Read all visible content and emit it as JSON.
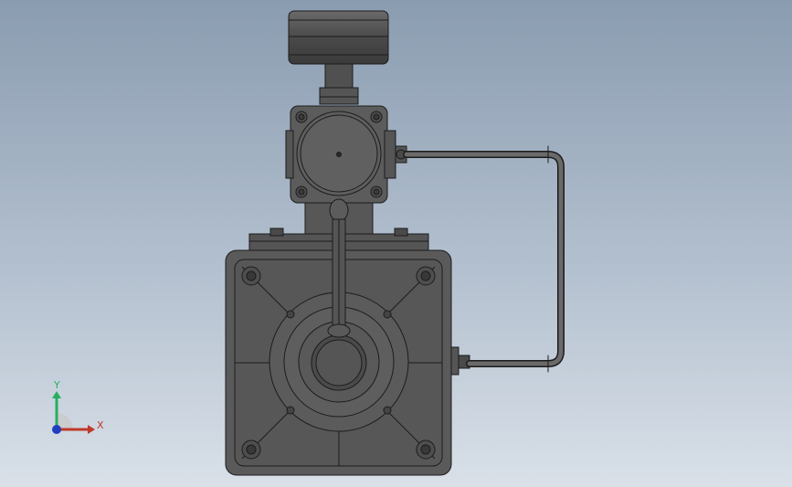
{
  "viewport": {
    "background_top": "#8a9cb0",
    "background_bottom": "#d9e0e8"
  },
  "model": {
    "body_fill": "#5a5a5a",
    "body_dark": "#3e3e3e",
    "edge_color": "#1c1c1c",
    "highlight": "#6f6f6f"
  },
  "triad": {
    "x_label": "X",
    "y_label": "Y",
    "x_color": "#c0392b",
    "y_color": "#27ae60",
    "z_color": "#1f3fbf"
  }
}
